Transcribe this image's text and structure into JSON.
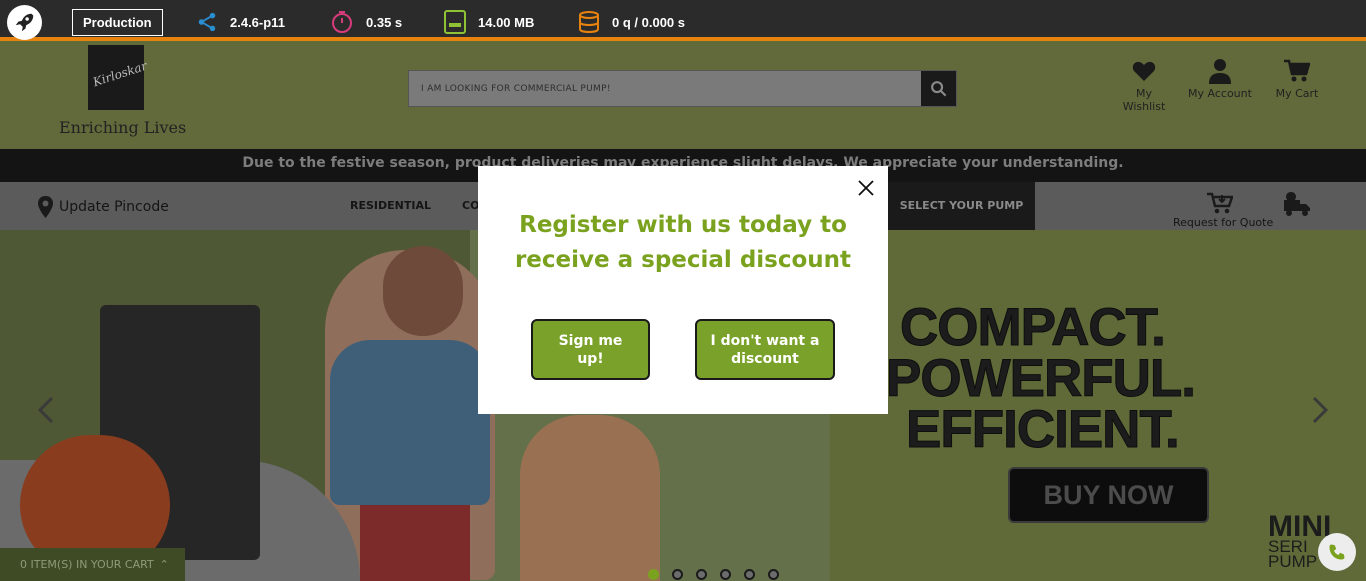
{
  "debug_toolbar": {
    "environment": "Production",
    "version": "2.4.6-p11",
    "time": "0.35 s",
    "memory": "14.00 MB",
    "queries": "0 q / 0.000 s"
  },
  "header": {
    "logo_text": "Kirloskar",
    "tagline": "Enriching Lives",
    "search": {
      "placeholder": "I AM LOOKING FOR COMMERCIAL PUMP!"
    },
    "links": [
      {
        "label": "My Wishlist",
        "icon": "heart-icon"
      },
      {
        "label": "My Account",
        "icon": "user-icon"
      },
      {
        "label": "My Cart",
        "icon": "cart-icon"
      }
    ]
  },
  "notice": "Due to the festive season, product deliveries may experience slight delays. We appreciate your understanding.",
  "nav": {
    "pincode": "Update Pincode",
    "items": [
      "RESIDENTIAL",
      "CO"
    ],
    "select_pump": "SELECT YOUR PUMP",
    "request_quote": "Request for Quote"
  },
  "hero": {
    "lines": [
      "COMPACT.",
      "POWERFUL.",
      "EFFICIENT."
    ],
    "cta": "BUY NOW",
    "brand_lines": [
      "MINI",
      "SERI",
      "PUMP"
    ],
    "slides": 6,
    "active_slide": 1
  },
  "mini_cart": "0 ITEM(S) IN YOUR CART",
  "modal": {
    "title": "Register with us today to receive a special discount",
    "primary_button": "Sign me up!",
    "secondary_button": "I don't want a discount"
  },
  "colors": {
    "accent_green": "#7aa21e",
    "toolbar_orange": "#e6820e"
  }
}
